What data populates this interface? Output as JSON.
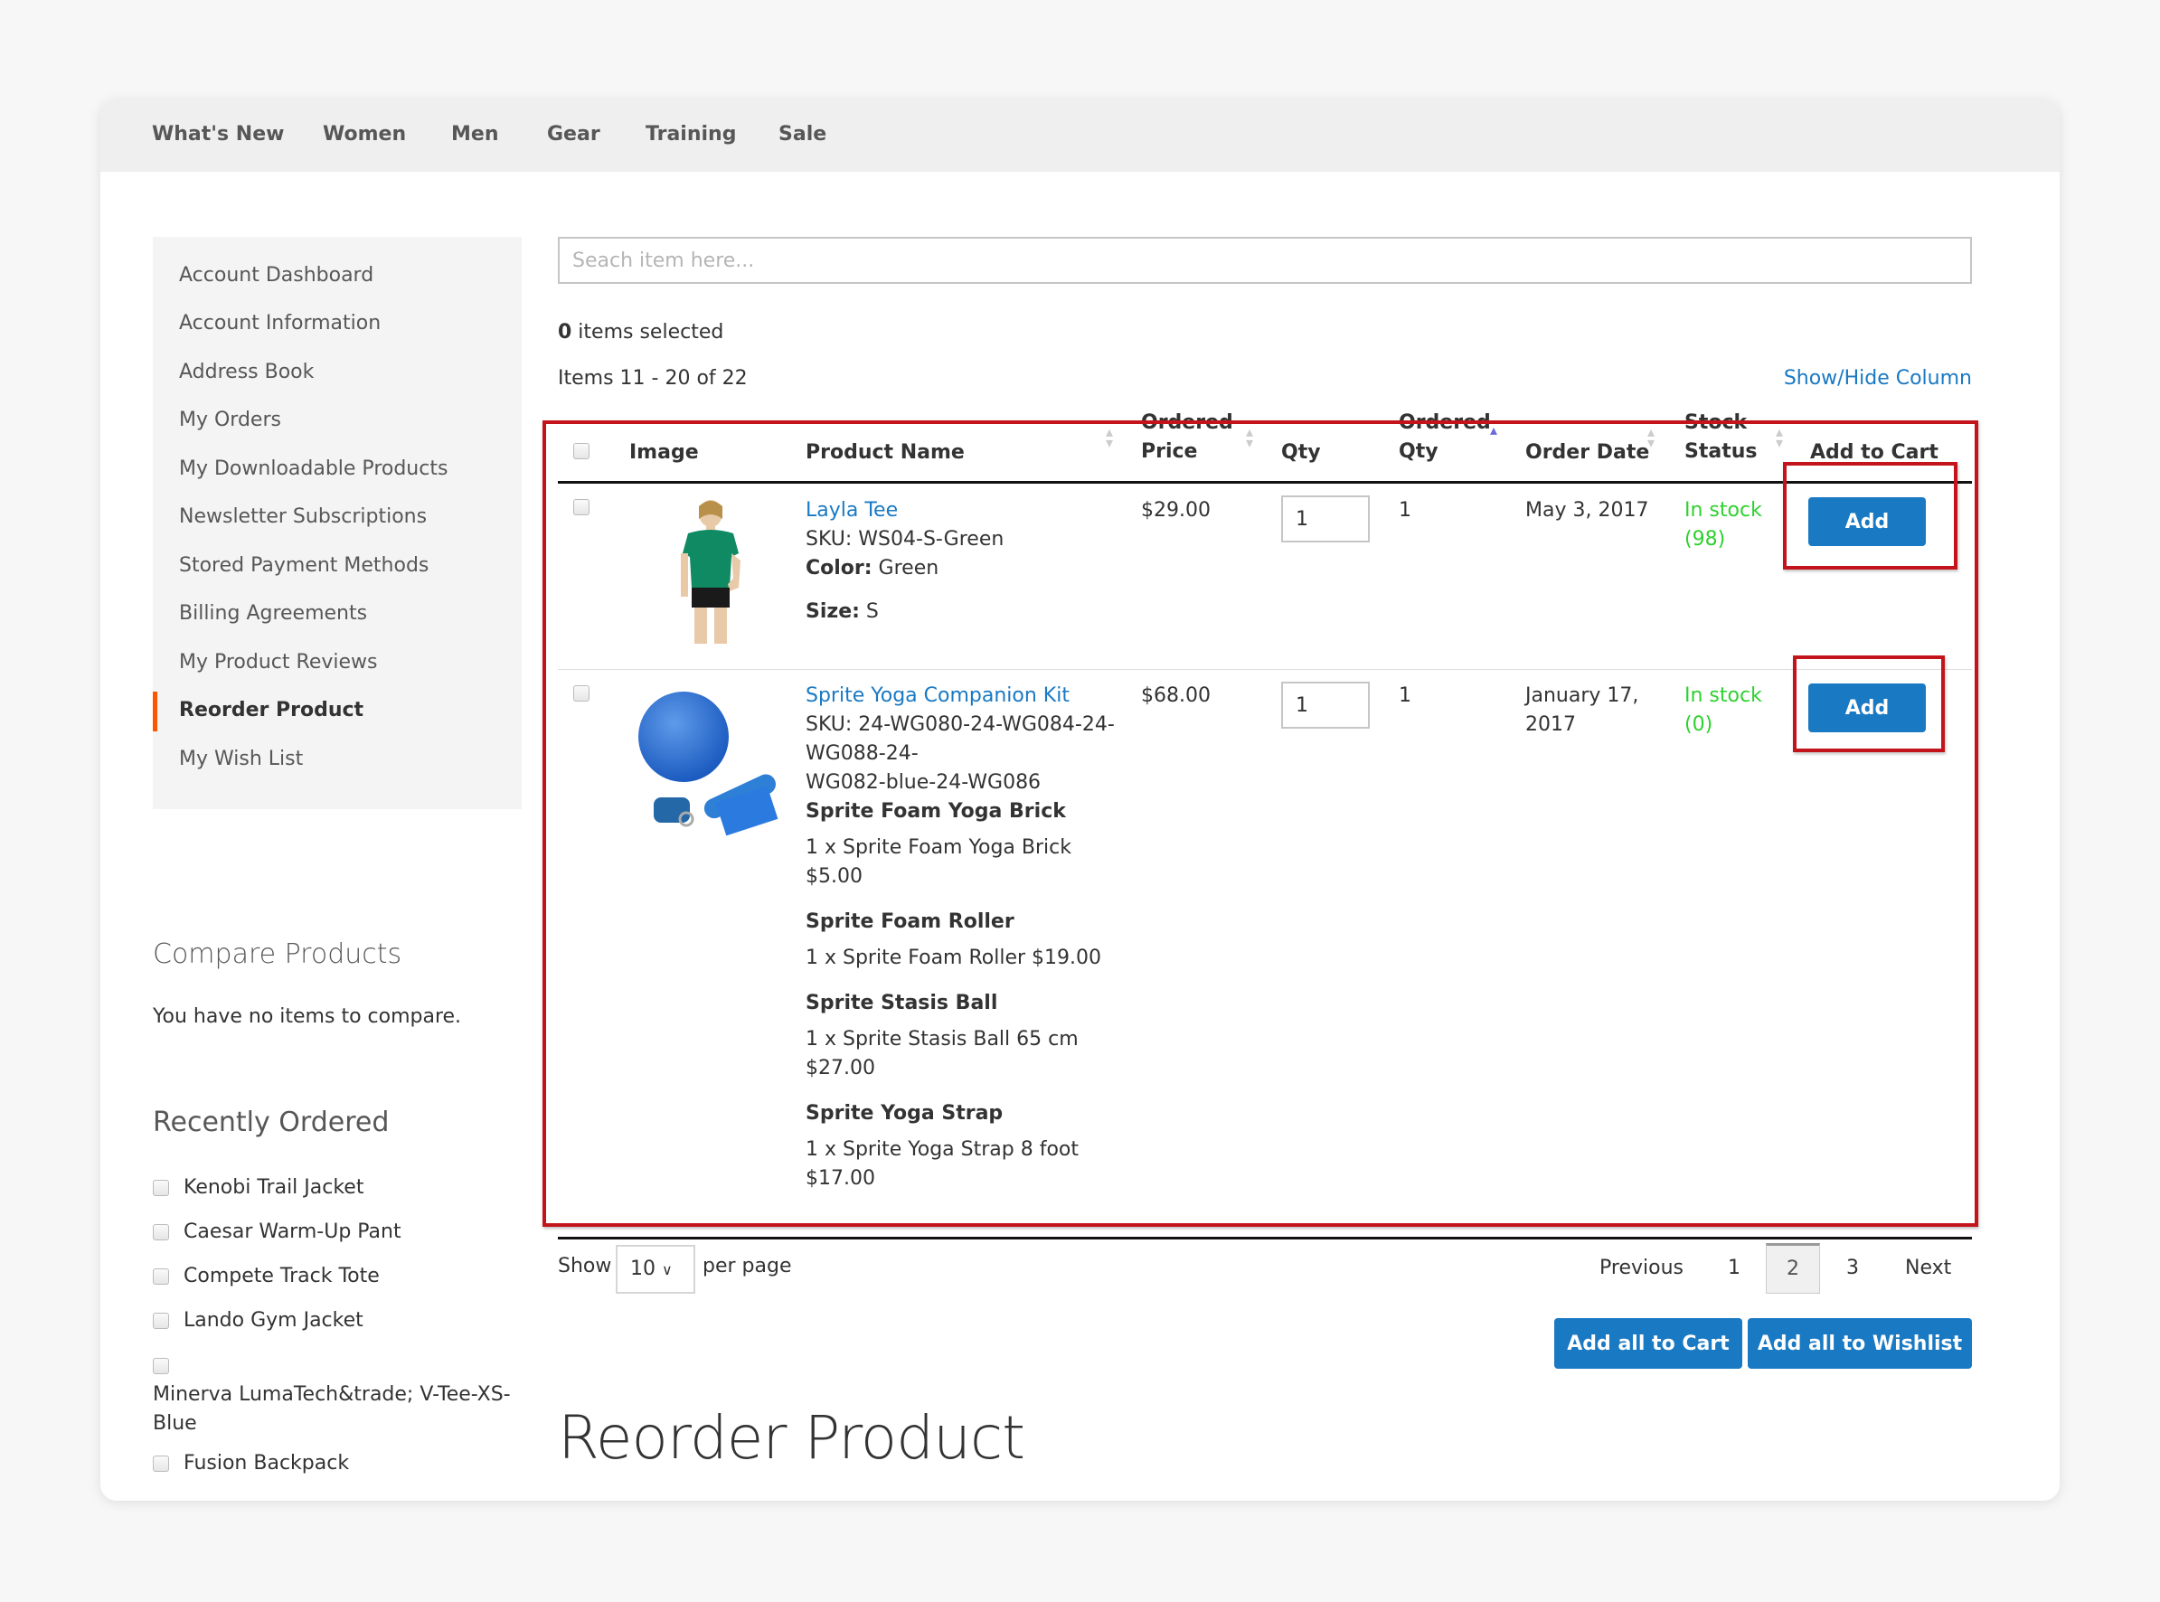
{
  "nav": {
    "items": [
      "What's New",
      "Women",
      "Men",
      "Gear",
      "Training",
      "Sale"
    ]
  },
  "sidebar": {
    "items": [
      {
        "label": "Account Dashboard"
      },
      {
        "label": "Account Information"
      },
      {
        "label": "Address Book"
      },
      {
        "label": "My Orders"
      },
      {
        "label": "My Downloadable Products"
      },
      {
        "label": "Newsletter Subscriptions"
      },
      {
        "label": "Stored Payment Methods"
      },
      {
        "label": "Billing Agreements"
      },
      {
        "label": "My Product Reviews"
      },
      {
        "label": "Reorder Product",
        "active": true
      },
      {
        "label": "My Wish List"
      }
    ],
    "active_marker_color": "#ff5501"
  },
  "compare": {
    "title": "Compare Products",
    "empty_text": "You have no items to compare."
  },
  "recently_ordered": {
    "title": "Recently Ordered",
    "items": [
      "Kenobi Trail Jacket",
      "Caesar Warm-Up Pant",
      "Compete Track Tote",
      "Lando Gym Jacket",
      "Minerva LumaTech&trade; V-Tee-XS-Blue",
      "Fusion Backpack"
    ]
  },
  "search": {
    "placeholder": "Seach item here...",
    "value": ""
  },
  "selection": {
    "count": "0",
    "label": " items selected"
  },
  "items_range": "Items 11 - 20 of 22",
  "show_hide_column": "Show/Hide Column",
  "table": {
    "headers": {
      "image": "Image",
      "product_name": "Product Name",
      "ordered_price_1": "Ordered",
      "ordered_price_2": "Price",
      "qty": "Qty",
      "ordered_qty_1": "Ordered",
      "ordered_qty_2": "Qty",
      "order_date": "Order Date",
      "stock_status_1": "Stock",
      "stock_status_2": "Status",
      "add_to_cart": "Add to Cart"
    },
    "sort_icon": "▴",
    "rows": [
      {
        "name": "Layla Tee",
        "sku": "SKU: WS04-S-Green",
        "color_label": "Color:",
        "color_value": " Green",
        "size_label": "Size:",
        "size_value": " S",
        "price": "$29.00",
        "qty": "1",
        "ordered_qty": "1",
        "order_date": "May 3, 2017",
        "stock": "In stock",
        "stock_count": "(98)",
        "add_label": "Add",
        "image": "green-tee-woman"
      },
      {
        "name": "Sprite Yoga Companion Kit",
        "sku_lines": [
          "SKU: 24-WG080-24-WG084-24-",
          "WG088-24-",
          "WG082-blue-24-WG086"
        ],
        "bundle": [
          {
            "title": "Sprite Foam Yoga Brick",
            "lines": [
              "1 x Sprite Foam Yoga Brick",
              "$5.00"
            ]
          },
          {
            "title": "Sprite Foam Roller",
            "lines": [
              "1 x Sprite Foam Roller $19.00"
            ]
          },
          {
            "title": "Sprite Stasis Ball",
            "lines": [
              "1 x Sprite Stasis Ball 65 cm",
              "$27.00"
            ]
          },
          {
            "title": "Sprite Yoga Strap",
            "lines": [
              "1 x Sprite Yoga Strap 8 foot",
              "$17.00"
            ]
          }
        ],
        "price": "$68.00",
        "qty": "1",
        "ordered_qty": "1",
        "order_date_lines": [
          "January 17,",
          "2017"
        ],
        "stock": "In stock",
        "stock_count": "(0)",
        "add_label": "Add",
        "image": "yoga-kit-blue"
      }
    ]
  },
  "pager": {
    "show_label": "Show",
    "limit_value": "10",
    "per_page_label": "per page",
    "previous": "Previous",
    "pages": [
      "1",
      "2",
      "3"
    ],
    "current_page": "2",
    "next": "Next"
  },
  "actions": {
    "add_all_to_cart": "Add all to Cart",
    "add_all_to_wishlist": "Add all to Wishlist"
  },
  "page_title": "Reorder Product",
  "colors": {
    "primary_button": "#1979c3",
    "link": "#1979c3",
    "in_stock": "#2ed12e",
    "highlight_box": "#c4141b"
  }
}
